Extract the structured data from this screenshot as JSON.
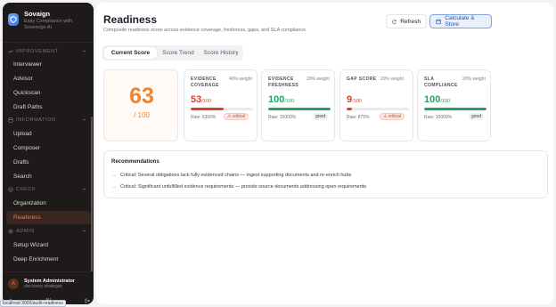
{
  "sidebar": {
    "brand_name": "Sovaign",
    "brand_sub": "Easy Compliance with Sovereign AI",
    "sections": [
      {
        "label": "IMPROVEMENT"
      },
      {
        "label": "INFORMATION"
      },
      {
        "label": "CHECK"
      },
      {
        "label": "ADMIN"
      }
    ],
    "items": [
      {
        "label": "Interviewer"
      },
      {
        "label": "Advisor"
      },
      {
        "label": "Quickscan"
      },
      {
        "label": "Draft Paths"
      },
      {
        "label": "Upload"
      },
      {
        "label": "Composer"
      },
      {
        "label": "Drafts"
      },
      {
        "label": "Search"
      },
      {
        "label": "Organization"
      },
      {
        "label": "Readiness"
      },
      {
        "label": "Setup Wizard"
      },
      {
        "label": "Deep Enrichment"
      }
    ],
    "user_name": "System Administrator",
    "user_role": "discovery strategist",
    "user_initial": "A",
    "lang": "NL",
    "status_url": "localhost:3000/audit-readiness"
  },
  "header": {
    "title": "Readiness",
    "subtitle": "Composite readiness score across evidence coverage, freshness, gaps, and SLA compliance",
    "refresh_label": "Refresh",
    "calc_label": "Calculate & Store"
  },
  "tabs": [
    {
      "label": "Current Score"
    },
    {
      "label": "Score Trend"
    },
    {
      "label": "Score History"
    }
  ],
  "score": {
    "value": "63",
    "max": "/ 100"
  },
  "metrics": [
    {
      "label": "EVIDENCE COVERAGE",
      "weight": "40% weight",
      "value": "53",
      "denom": "/100",
      "progress": 0.53,
      "raw": "Raw: 5300%",
      "badge": "⚠ critical",
      "status": "critical",
      "color": "#d9412e"
    },
    {
      "label": "EVIDENCE FRESHNESS",
      "weight": "20% weight",
      "value": "100",
      "denom": "/100",
      "progress": 1.0,
      "raw": "Raw: 10000%",
      "badge": "good",
      "status": "good",
      "color": "#27a067"
    },
    {
      "label": "GAP SCORE",
      "weight": "20% weight",
      "value": "9",
      "denom": "/100",
      "progress": 0.09,
      "raw": "Raw: 875%",
      "badge": "⚠ critical",
      "status": "critical",
      "color": "#d9412e"
    },
    {
      "label": "SLA COMPLIANCE",
      "weight": "20% weight",
      "value": "100",
      "denom": "/100",
      "progress": 1.0,
      "raw": "Raw: 10000%",
      "badge": "good",
      "status": "good",
      "color": "#27a067"
    }
  ],
  "recommendations": {
    "title": "Recommendations",
    "items": [
      "Critical: Several obligations lack fully evidenced chains — ingest supporting documents and re-enrich hubs",
      "Critical: Significant unfulfilled evidence requirements — provide source documents addressing open requirements"
    ]
  },
  "colors": {
    "accent": "#ef7d35",
    "critical": "#d9412e",
    "good": "#27a067",
    "primary": "#2456a6"
  }
}
